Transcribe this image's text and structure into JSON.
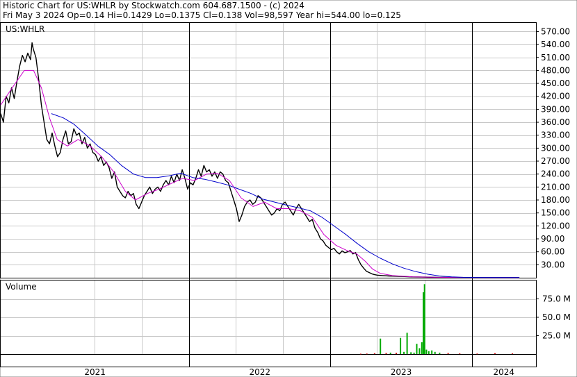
{
  "header": {
    "line1": "Historic Chart for US:WHLR by Stockwatch.com 604.687.1500 - (c) 2024",
    "line2": "Fri May  3 2024   Op=0.14   Hi=0.1429   Lo=0.1375   Cl=0.138   Vol=98,597   Year hi=544.00   lo=0.125"
  },
  "chart_data": {
    "type": "line",
    "symbol_label": "US:WHLR",
    "volume_label": "Volume",
    "price_axis": {
      "ticks": [
        570,
        540,
        510,
        480,
        450,
        420,
        390,
        360,
        330,
        300,
        270,
        240,
        210,
        180,
        150,
        120,
        90,
        60,
        30
      ],
      "tick_labels": [
        "570.00",
        "540.00",
        "510.00",
        "480.00",
        "450.00",
        "420.00",
        "390.00",
        "360.00",
        "330.00",
        "300.00",
        "270.00",
        "240.00",
        "210.00",
        "180.00",
        "150.00",
        "120.00",
        "90.00",
        "60.00",
        "30.00"
      ],
      "ylim": [
        0,
        590
      ]
    },
    "volume_axis": {
      "ticks": [
        75,
        50,
        25
      ],
      "tick_labels": [
        "75.0 M",
        "50.0 M",
        "25.0 M"
      ],
      "ylim": [
        0,
        100
      ]
    },
    "x_axis": {
      "year_labels": [
        "2021",
        "2022",
        "2023",
        "2024"
      ],
      "year_boundaries": [
        "2022-01-01",
        "2023-01-01",
        "2024-01-01"
      ],
      "xlim": [
        "2020-09-01",
        "2024-06-15"
      ],
      "vertical_gridlines": [
        "2021-05-01",
        "2021-09-01",
        "2022-05-01",
        "2022-09-01",
        "2023-05-01",
        "2023-09-01"
      ]
    },
    "series": [
      {
        "role": "price",
        "color": "#000000",
        "points": [
          [
            "2020-09-01",
            380
          ],
          [
            "2020-09-08",
            360
          ],
          [
            "2020-09-15",
            420
          ],
          [
            "2020-09-22",
            405
          ],
          [
            "2020-09-29",
            440
          ],
          [
            "2020-10-06",
            415
          ],
          [
            "2020-10-13",
            455
          ],
          [
            "2020-10-20",
            490
          ],
          [
            "2020-10-27",
            515
          ],
          [
            "2020-11-03",
            500
          ],
          [
            "2020-11-10",
            520
          ],
          [
            "2020-11-17",
            505
          ],
          [
            "2020-11-21",
            544
          ],
          [
            "2020-11-24",
            530
          ],
          [
            "2020-12-01",
            510
          ],
          [
            "2020-12-08",
            460
          ],
          [
            "2020-12-15",
            400
          ],
          [
            "2020-12-22",
            360
          ],
          [
            "2020-12-29",
            320
          ],
          [
            "2021-01-05",
            310
          ],
          [
            "2021-01-12",
            335
          ],
          [
            "2021-01-19",
            305
          ],
          [
            "2021-01-26",
            280
          ],
          [
            "2021-02-02",
            290
          ],
          [
            "2021-02-09",
            320
          ],
          [
            "2021-02-16",
            340
          ],
          [
            "2021-02-23",
            310
          ],
          [
            "2021-03-02",
            315
          ],
          [
            "2021-03-09",
            345
          ],
          [
            "2021-03-16",
            330
          ],
          [
            "2021-03-23",
            335
          ],
          [
            "2021-03-30",
            310
          ],
          [
            "2021-04-06",
            325
          ],
          [
            "2021-04-13",
            300
          ],
          [
            "2021-04-20",
            310
          ],
          [
            "2021-04-27",
            290
          ],
          [
            "2021-05-04",
            285
          ],
          [
            "2021-05-11",
            270
          ],
          [
            "2021-05-18",
            280
          ],
          [
            "2021-05-25",
            260
          ],
          [
            "2021-06-01",
            268
          ],
          [
            "2021-06-08",
            255
          ],
          [
            "2021-06-15",
            230
          ],
          [
            "2021-06-22",
            245
          ],
          [
            "2021-06-29",
            210
          ],
          [
            "2021-07-06",
            200
          ],
          [
            "2021-07-13",
            190
          ],
          [
            "2021-07-20",
            185
          ],
          [
            "2021-07-27",
            200
          ],
          [
            "2021-08-03",
            190
          ],
          [
            "2021-08-10",
            195
          ],
          [
            "2021-08-17",
            170
          ],
          [
            "2021-08-24",
            160
          ],
          [
            "2021-08-31",
            175
          ],
          [
            "2021-09-07",
            190
          ],
          [
            "2021-09-14",
            200
          ],
          [
            "2021-09-21",
            210
          ],
          [
            "2021-09-28",
            195
          ],
          [
            "2021-10-05",
            205
          ],
          [
            "2021-10-12",
            210
          ],
          [
            "2021-10-19",
            200
          ],
          [
            "2021-10-26",
            215
          ],
          [
            "2021-11-02",
            225
          ],
          [
            "2021-11-09",
            215
          ],
          [
            "2021-11-16",
            235
          ],
          [
            "2021-11-23",
            220
          ],
          [
            "2021-11-30",
            240
          ],
          [
            "2021-12-07",
            225
          ],
          [
            "2021-12-14",
            250
          ],
          [
            "2021-12-21",
            230
          ],
          [
            "2021-12-28",
            205
          ],
          [
            "2022-01-04",
            220
          ],
          [
            "2022-01-11",
            215
          ],
          [
            "2022-01-18",
            230
          ],
          [
            "2022-01-25",
            250
          ],
          [
            "2022-02-01",
            235
          ],
          [
            "2022-02-08",
            260
          ],
          [
            "2022-02-15",
            245
          ],
          [
            "2022-02-22",
            250
          ],
          [
            "2022-03-01",
            235
          ],
          [
            "2022-03-08",
            245
          ],
          [
            "2022-03-15",
            230
          ],
          [
            "2022-03-22",
            245
          ],
          [
            "2022-03-29",
            240
          ],
          [
            "2022-04-05",
            225
          ],
          [
            "2022-04-12",
            220
          ],
          [
            "2022-04-19",
            200
          ],
          [
            "2022-04-26",
            180
          ],
          [
            "2022-05-03",
            160
          ],
          [
            "2022-05-10",
            130
          ],
          [
            "2022-05-17",
            145
          ],
          [
            "2022-05-24",
            165
          ],
          [
            "2022-05-31",
            175
          ],
          [
            "2022-06-07",
            180
          ],
          [
            "2022-06-14",
            170
          ],
          [
            "2022-06-21",
            175
          ],
          [
            "2022-06-28",
            190
          ],
          [
            "2022-07-05",
            185
          ],
          [
            "2022-07-12",
            175
          ],
          [
            "2022-07-19",
            165
          ],
          [
            "2022-07-26",
            155
          ],
          [
            "2022-08-02",
            145
          ],
          [
            "2022-08-09",
            150
          ],
          [
            "2022-08-16",
            160
          ],
          [
            "2022-08-23",
            155
          ],
          [
            "2022-08-30",
            170
          ],
          [
            "2022-09-06",
            175
          ],
          [
            "2022-09-13",
            165
          ],
          [
            "2022-09-20",
            155
          ],
          [
            "2022-09-27",
            145
          ],
          [
            "2022-10-04",
            160
          ],
          [
            "2022-10-11",
            170
          ],
          [
            "2022-10-18",
            160
          ],
          [
            "2022-10-25",
            150
          ],
          [
            "2022-11-01",
            140
          ],
          [
            "2022-11-08",
            130
          ],
          [
            "2022-11-15",
            135
          ],
          [
            "2022-11-22",
            115
          ],
          [
            "2022-11-29",
            105
          ],
          [
            "2022-12-06",
            90
          ],
          [
            "2022-12-13",
            85
          ],
          [
            "2022-12-20",
            75
          ],
          [
            "2022-12-27",
            70
          ],
          [
            "2023-01-03",
            65
          ],
          [
            "2023-01-10",
            68
          ],
          [
            "2023-01-17",
            60
          ],
          [
            "2023-01-24",
            55
          ],
          [
            "2023-01-31",
            62
          ],
          [
            "2023-02-07",
            58
          ],
          [
            "2023-02-14",
            60
          ],
          [
            "2023-02-21",
            63
          ],
          [
            "2023-02-28",
            55
          ],
          [
            "2023-03-07",
            58
          ],
          [
            "2023-03-14",
            42
          ],
          [
            "2023-03-21",
            30
          ],
          [
            "2023-03-28",
            22
          ],
          [
            "2023-04-04",
            15
          ],
          [
            "2023-04-11",
            12
          ],
          [
            "2023-04-18",
            9
          ],
          [
            "2023-04-25",
            7
          ],
          [
            "2023-05-02",
            6
          ],
          [
            "2023-05-16",
            5
          ],
          [
            "2023-06-01",
            4
          ],
          [
            "2023-07-01",
            3
          ],
          [
            "2023-08-01",
            2
          ],
          [
            "2023-09-01",
            1.5
          ],
          [
            "2023-10-01",
            1
          ],
          [
            "2023-11-01",
            0.6
          ],
          [
            "2023-12-01",
            0.4
          ],
          [
            "2024-01-01",
            0.3
          ],
          [
            "2024-02-01",
            0.2
          ],
          [
            "2024-03-01",
            0.16
          ],
          [
            "2024-04-01",
            0.14
          ],
          [
            "2024-05-03",
            0.138
          ]
        ]
      },
      {
        "role": "short-moving-average",
        "color": "#cc00cc",
        "points": [
          [
            "2020-09-01",
            400
          ],
          [
            "2020-10-01",
            440
          ],
          [
            "2020-11-01",
            480
          ],
          [
            "2020-11-25",
            480
          ],
          [
            "2020-12-15",
            440
          ],
          [
            "2021-01-05",
            370
          ],
          [
            "2021-01-25",
            320
          ],
          [
            "2021-02-20",
            305
          ],
          [
            "2021-03-20",
            320
          ],
          [
            "2021-04-20",
            305
          ],
          [
            "2021-05-20",
            280
          ],
          [
            "2021-06-20",
            245
          ],
          [
            "2021-07-20",
            200
          ],
          [
            "2021-08-15",
            180
          ],
          [
            "2021-09-15",
            195
          ],
          [
            "2021-10-15",
            205
          ],
          [
            "2021-11-15",
            218
          ],
          [
            "2021-12-15",
            230
          ],
          [
            "2022-01-15",
            225
          ],
          [
            "2022-02-15",
            240
          ],
          [
            "2022-03-15",
            242
          ],
          [
            "2022-04-15",
            225
          ],
          [
            "2022-05-15",
            185
          ],
          [
            "2022-06-15",
            165
          ],
          [
            "2022-07-15",
            175
          ],
          [
            "2022-08-15",
            160
          ],
          [
            "2022-09-15",
            160
          ],
          [
            "2022-10-15",
            155
          ],
          [
            "2022-11-15",
            140
          ],
          [
            "2022-12-15",
            100
          ],
          [
            "2023-01-15",
            75
          ],
          [
            "2023-02-15",
            62
          ],
          [
            "2023-03-10",
            55
          ],
          [
            "2023-04-01",
            38
          ],
          [
            "2023-04-20",
            20
          ],
          [
            "2023-05-10",
            10
          ],
          [
            "2023-06-10",
            5
          ],
          [
            "2023-08-01",
            2
          ],
          [
            "2023-10-01",
            1
          ],
          [
            "2024-01-01",
            0.4
          ],
          [
            "2024-05-03",
            0.2
          ]
        ]
      },
      {
        "role": "long-moving-average",
        "color": "#0000cc",
        "points": [
          [
            "2021-01-10",
            380
          ],
          [
            "2021-02-10",
            370
          ],
          [
            "2021-03-10",
            355
          ],
          [
            "2021-04-10",
            330
          ],
          [
            "2021-05-10",
            305
          ],
          [
            "2021-06-10",
            285
          ],
          [
            "2021-07-10",
            260
          ],
          [
            "2021-08-10",
            240
          ],
          [
            "2021-09-10",
            232
          ],
          [
            "2021-10-10",
            232
          ],
          [
            "2021-11-10",
            236
          ],
          [
            "2021-12-10",
            242
          ],
          [
            "2022-01-10",
            232
          ],
          [
            "2022-02-10",
            228
          ],
          [
            "2022-03-10",
            222
          ],
          [
            "2022-04-10",
            215
          ],
          [
            "2022-05-10",
            205
          ],
          [
            "2022-06-10",
            195
          ],
          [
            "2022-07-10",
            182
          ],
          [
            "2022-08-10",
            175
          ],
          [
            "2022-09-10",
            168
          ],
          [
            "2022-10-10",
            162
          ],
          [
            "2022-11-10",
            155
          ],
          [
            "2022-12-10",
            140
          ],
          [
            "2023-01-10",
            120
          ],
          [
            "2023-02-10",
            100
          ],
          [
            "2023-03-10",
            80
          ],
          [
            "2023-04-10",
            60
          ],
          [
            "2023-05-10",
            45
          ],
          [
            "2023-06-10",
            32
          ],
          [
            "2023-07-10",
            22
          ],
          [
            "2023-08-10",
            14
          ],
          [
            "2023-09-10",
            8
          ],
          [
            "2023-10-10",
            4
          ],
          [
            "2023-11-10",
            2
          ],
          [
            "2023-12-10",
            1
          ],
          [
            "2024-01-10",
            0.6
          ],
          [
            "2024-05-03",
            0.3
          ]
        ]
      }
    ],
    "volume": {
      "color": "#00aa00",
      "down_color": "#cc0000",
      "bars": [
        [
          "2023-03-20",
          0.6
        ],
        [
          "2023-04-05",
          0.8
        ],
        [
          "2023-04-25",
          1.2
        ],
        [
          "2023-05-10",
          21
        ],
        [
          "2023-05-25",
          1.5
        ],
        [
          "2023-06-05",
          2
        ],
        [
          "2023-06-20",
          1.8
        ],
        [
          "2023-07-01",
          22
        ],
        [
          "2023-07-10",
          3
        ],
        [
          "2023-07-18",
          29
        ],
        [
          "2023-07-28",
          2.5
        ],
        [
          "2023-08-05",
          2
        ],
        [
          "2023-08-12",
          14
        ],
        [
          "2023-08-19",
          8
        ],
        [
          "2023-08-25",
          16
        ],
        [
          "2023-08-29",
          84
        ],
        [
          "2023-09-01",
          95
        ],
        [
          "2023-09-06",
          6
        ],
        [
          "2023-09-12",
          4
        ],
        [
          "2023-09-20",
          5
        ],
        [
          "2023-09-28",
          3
        ],
        [
          "2023-10-10",
          2
        ],
        [
          "2023-11-01",
          1.5
        ],
        [
          "2023-12-01",
          1
        ],
        [
          "2024-01-15",
          0.8
        ],
        [
          "2024-03-01",
          1.2
        ],
        [
          "2024-04-15",
          0.9
        ]
      ]
    }
  }
}
